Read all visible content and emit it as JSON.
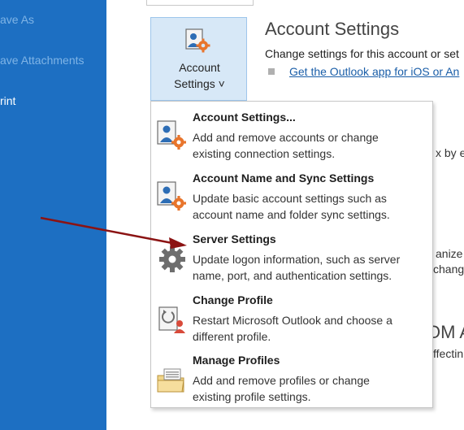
{
  "sidebar": {
    "items": [
      {
        "label": "ave As"
      },
      {
        "label": "ave Attachments"
      },
      {
        "label": "rint"
      }
    ]
  },
  "account_button": {
    "line1": "Account",
    "line2": "Settings ˅"
  },
  "section": {
    "title": "Account Settings",
    "description": "Change settings for this account or set",
    "link": "Get the Outlook app for iOS or An"
  },
  "background_fragments": [
    "x by e",
    "anize",
    "chang",
    "OM A",
    "ffectin"
  ],
  "menu": {
    "items": [
      {
        "title": "Account Settings...",
        "desc1": "Add and remove accounts or change",
        "desc2": "existing connection settings.",
        "icon": "account-settings-icon"
      },
      {
        "title": "Account Name and Sync Settings",
        "desc1": "Update basic account settings such as",
        "desc2": "account name and folder sync settings.",
        "icon": "account-name-sync-icon"
      },
      {
        "title": "Server Settings",
        "desc1": "Update logon information, such as server",
        "desc2": "name, port, and authentication settings.",
        "icon": "gear-icon"
      },
      {
        "title": "Change Profile",
        "desc1": "Restart Microsoft Outlook and choose a",
        "desc2": "different profile.",
        "icon": "change-profile-icon"
      },
      {
        "title": "Manage Profiles",
        "desc1": "Add and remove profiles or change",
        "desc2": "existing profile settings.",
        "icon": "manage-profiles-icon"
      }
    ]
  },
  "colors": {
    "sidebar": "#1d6fc2",
    "accent": "#e8752c",
    "annotation_arrow": "#8b1313",
    "link": "#1a5ea8"
  }
}
